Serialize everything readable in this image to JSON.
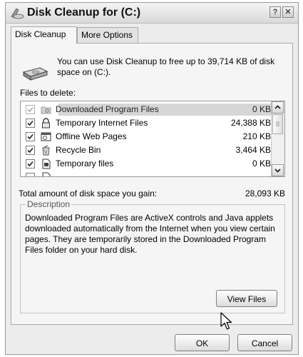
{
  "window": {
    "title": "Disk Cleanup for  (C:)",
    "help_button": "?",
    "close_button": "✕"
  },
  "tabs": [
    {
      "label": "Disk Cleanup",
      "active": true
    },
    {
      "label": "More Options",
      "active": false
    }
  ],
  "intro_text": "You can use Disk Cleanup to free up to 39,714 KB of disk space on  (C:).",
  "files_label": "Files to delete:",
  "files": [
    {
      "name": "Downloaded Program Files",
      "size": "0 KB",
      "checked": true,
      "enabled": false,
      "selected": true,
      "icon": "folder-icon"
    },
    {
      "name": "Temporary Internet Files",
      "size": "24,388 KB",
      "checked": true,
      "enabled": true,
      "selected": false,
      "icon": "lock-icon"
    },
    {
      "name": "Offline Web Pages",
      "size": "210 KB",
      "checked": true,
      "enabled": true,
      "selected": false,
      "icon": "web-page-icon"
    },
    {
      "name": "Recycle Bin",
      "size": "3,464 KB",
      "checked": true,
      "enabled": true,
      "selected": false,
      "icon": "recycle-bin-icon"
    },
    {
      "name": "Temporary files",
      "size": "0 KB",
      "checked": true,
      "enabled": true,
      "selected": false,
      "icon": "temp-file-icon"
    }
  ],
  "total": {
    "label": "Total amount of disk space you gain:",
    "value": "28,093 KB"
  },
  "description": {
    "legend": "Description",
    "text": "Downloaded Program Files are ActiveX controls and Java applets downloaded automatically from the Internet when you view certain pages. They are temporarily stored in the Downloaded Program Files folder on your hard disk."
  },
  "buttons": {
    "view_files": "View Files",
    "ok": "OK",
    "cancel": "Cancel"
  }
}
